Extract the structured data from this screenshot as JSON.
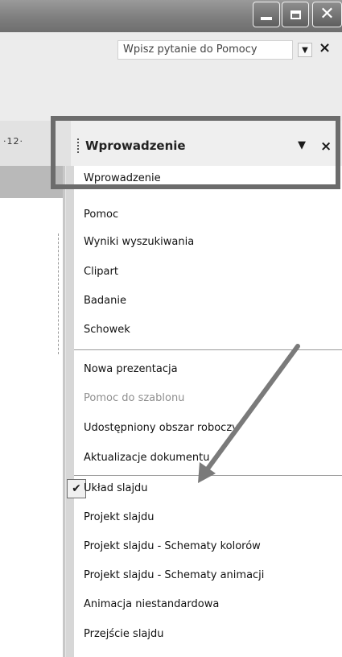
{
  "window_controls": {
    "minimize_icon": "minimize-icon",
    "maximize_icon": "restore-icon",
    "close_icon": "close-icon"
  },
  "help": {
    "placeholder": "Wpisz pytanie do Pomocy",
    "close": "×"
  },
  "ruler": {
    "label": "·12·"
  },
  "task_pane": {
    "title": "Wprowadzenie",
    "dropdown": "▼",
    "close": "×"
  },
  "menu": {
    "items": [
      "Wprowadzenie",
      "Pomoc",
      "Wyniki wyszukiwania",
      "Clipart",
      "Badanie",
      "Schowek",
      "Nowa prezentacja",
      "Pomoc do szablonu",
      "Udostępniony obszar roboczy",
      "Aktualizacje dokumentu",
      "Układ slajdu",
      "Projekt slajdu",
      "Projekt slajdu - Schematy kolorów",
      "Projekt slajdu - Schematy animacji",
      "Animacja niestandardowa",
      "Przejście slajdu"
    ],
    "checked_item": "Układ slajdu",
    "disabled_item": "Pomoc do szablonu",
    "check_mark": "✔"
  },
  "colors": {
    "highlight": "#6c6c6c",
    "arrow": "#7a7a7a"
  }
}
